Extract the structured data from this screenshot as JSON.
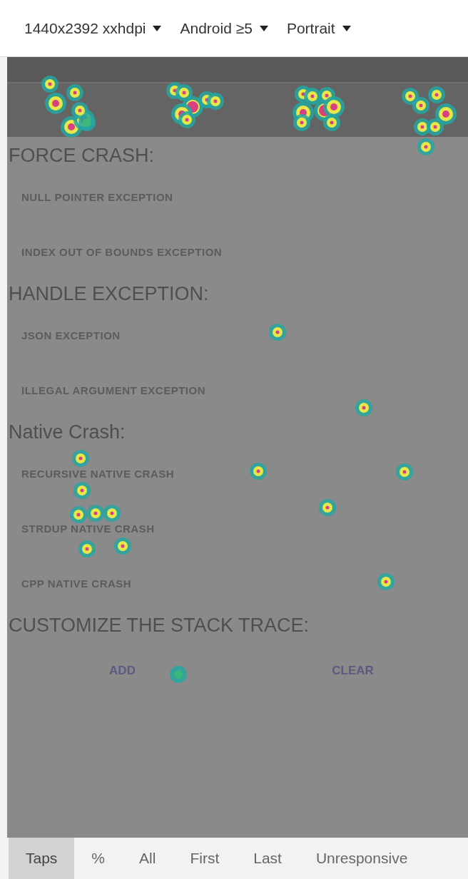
{
  "toolbar": {
    "dropdowns": [
      {
        "label": "1440x2392 xxhdpi"
      },
      {
        "label": "Android ≥5"
      },
      {
        "label": "Portrait"
      }
    ]
  },
  "app_screen": {
    "sections": [
      {
        "heading": "FORCE CRASH:",
        "items": [
          "NULL POINTER EXCEPTION",
          "INDEX OUT OF BOUNDS EXCEPTION"
        ]
      },
      {
        "heading": "HANDLE EXCEPTION:",
        "items": [
          "JSON EXCEPTION",
          "ILLEGAL ARGUMENT EXCEPTION"
        ]
      },
      {
        "heading": "Native Crash:",
        "items": [
          "RECURSIVE NATIVE CRASH",
          "STRDUP NATIVE CRASH",
          "CPP NATIVE CRASH"
        ]
      },
      {
        "heading": "CUSTOMIZE THE STACK TRACE:"
      }
    ],
    "buttons": [
      "ADD",
      "CLEAR"
    ]
  },
  "modes": [
    {
      "label": "Taps",
      "selected": true
    },
    {
      "label": "%",
      "selected": false
    },
    {
      "label": "All",
      "selected": false
    },
    {
      "label": "First",
      "selected": false
    },
    {
      "label": "Last",
      "selected": false
    },
    {
      "label": "Unresponsive",
      "selected": false
    }
  ]
}
